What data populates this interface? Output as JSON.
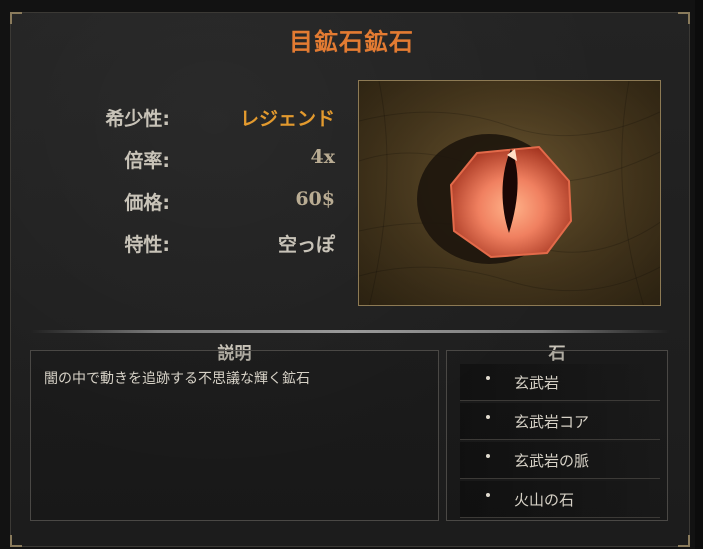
{
  "title": "目鉱石鉱石",
  "stats": [
    {
      "label": "希少性:",
      "value": "レジェンド"
    },
    {
      "label": "倍率:",
      "value": "4x"
    },
    {
      "label": "価格:",
      "value": "60$"
    },
    {
      "label": "特性:",
      "value": "空っぽ"
    }
  ],
  "description": {
    "heading": "説明",
    "text": "闇の中で動きを追跡する不思議な輝く鉱石"
  },
  "stones": {
    "heading": "石",
    "items": [
      "玄武岩",
      "玄武岩コア",
      "玄武岩の脈",
      "火山の石"
    ]
  },
  "colors": {
    "title": "#e37b32",
    "rarity": "#e39a2e",
    "ore_glow": "#f08060"
  },
  "icons": {
    "preview": "ore-eye-icon"
  }
}
